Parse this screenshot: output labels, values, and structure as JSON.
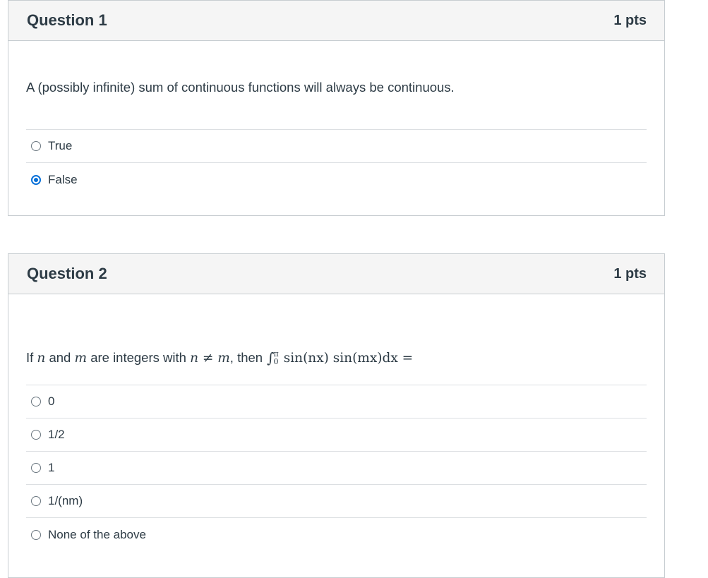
{
  "questions": [
    {
      "title": "Question 1",
      "points": "1 pts",
      "text": "A (possibly infinite) sum of continuous functions will always be continuous.",
      "answers": [
        {
          "label": "True",
          "selected": false
        },
        {
          "label": "False",
          "selected": true
        }
      ]
    },
    {
      "title": "Question 2",
      "points": "1 pts",
      "text_parts": {
        "p1": "If ",
        "n": "n",
        "p2": " and ",
        "m": "m",
        "p3": " are integers with ",
        "cond": "n ≠ m",
        "p4": ", then ",
        "int_sign": "∫",
        "int_upper": "π",
        "int_lower": "0",
        "integrand": "sin(nx) sin(mx)dx =",
        "n_letter": "n",
        "m_letter": "m",
        "x_letter": "x"
      },
      "answers": [
        {
          "label": "0",
          "selected": false
        },
        {
          "label": "1/2",
          "selected": false
        },
        {
          "label": "1",
          "selected": false
        },
        {
          "label": "1/(nm)",
          "selected": false
        },
        {
          "label": "None of the above",
          "selected": false
        }
      ]
    }
  ],
  "colors": {
    "accent": "#0770d8",
    "header_bg": "#f5f5f5",
    "border": "#c7cdd1",
    "text": "#2d3b45"
  }
}
